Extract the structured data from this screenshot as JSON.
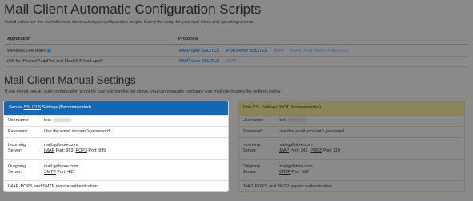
{
  "auto": {
    "title": "Mail Client Automatic Configuration Scripts",
    "description": "Listed below are the available mail client automatic configuration scripts. Select the script for your mail client and operating system.",
    "col_application": "Application",
    "col_protocols": "Protocols",
    "rows": [
      {
        "app": "Windows Live Mail®",
        "imap_ssl": "IMAP over SSL/TLS",
        "pop3_ssl": "POP3 over SSL/TLS",
        "imap": "IMAP",
        "pop3": "POP3 (Post Office Protocol v3)"
      },
      {
        "app": "iOS for iPhone/iPad/iPod and MacOS® Mail.app®",
        "imap_ssl": "IMAP over SSL/TLS",
        "imap": "IMAP"
      }
    ]
  },
  "manual": {
    "title": "Mail Client Manual Settings",
    "description": "If you do not see an auto-configuration script for your client in the list above, you can manually configure your mail client using the settings below:",
    "secure": {
      "header_prefix": "Secure ",
      "header_link": "SSL/TLS",
      "header_suffix": " Settings (Recommended)",
      "username_label": "Username:",
      "username_value": "test",
      "password_label": "Password:",
      "password_value": "Use the email account’s password.",
      "incoming_label_1": "Incoming",
      "incoming_label_2": "Server:",
      "incoming_host": "mail.gpfstore.com",
      "imap_label": "IMAP",
      "imap_port": "Port: 993",
      "pop3_label": "POP3",
      "pop3_port": "Port: 995",
      "outgoing_label_1": "Outgoing",
      "outgoing_label_2": "Server:",
      "outgoing_host": "mail.gpfstore.com",
      "smtp_label": "SMTP",
      "smtp_port": "Port: 465",
      "footer": "IMAP, POP3, and SMTP require authentication."
    },
    "nonssl": {
      "header": "Non-SSL Settings (NOT Recommended)",
      "username_label": "Username:",
      "username_value": "test",
      "password_label": "Password:",
      "password_value": "Use the email account’s password.",
      "incoming_label_1": "Incoming",
      "incoming_label_2": "Server:",
      "incoming_host": "mail.gpfstore.com",
      "imap_label": "IMAP",
      "imap_port": "Port: 143",
      "pop3_label": "POP3",
      "pop3_port": "Port: 110",
      "outgoing_label_1": "Outgoing",
      "outgoing_label_2": "Server:",
      "outgoing_host": "mail.gpfstore.com",
      "smtp_label": "SMTP",
      "smtp_port": "Port: 587",
      "footer": "IMAP, POP3, and SMTP require authentication."
    }
  },
  "colors": {
    "overlay_bg": "#8a8a8a",
    "secure_header": "#1667b3",
    "nonssl_header": "#8b8456",
    "link": "#234e86"
  },
  "icons": {
    "info": "info-icon"
  }
}
